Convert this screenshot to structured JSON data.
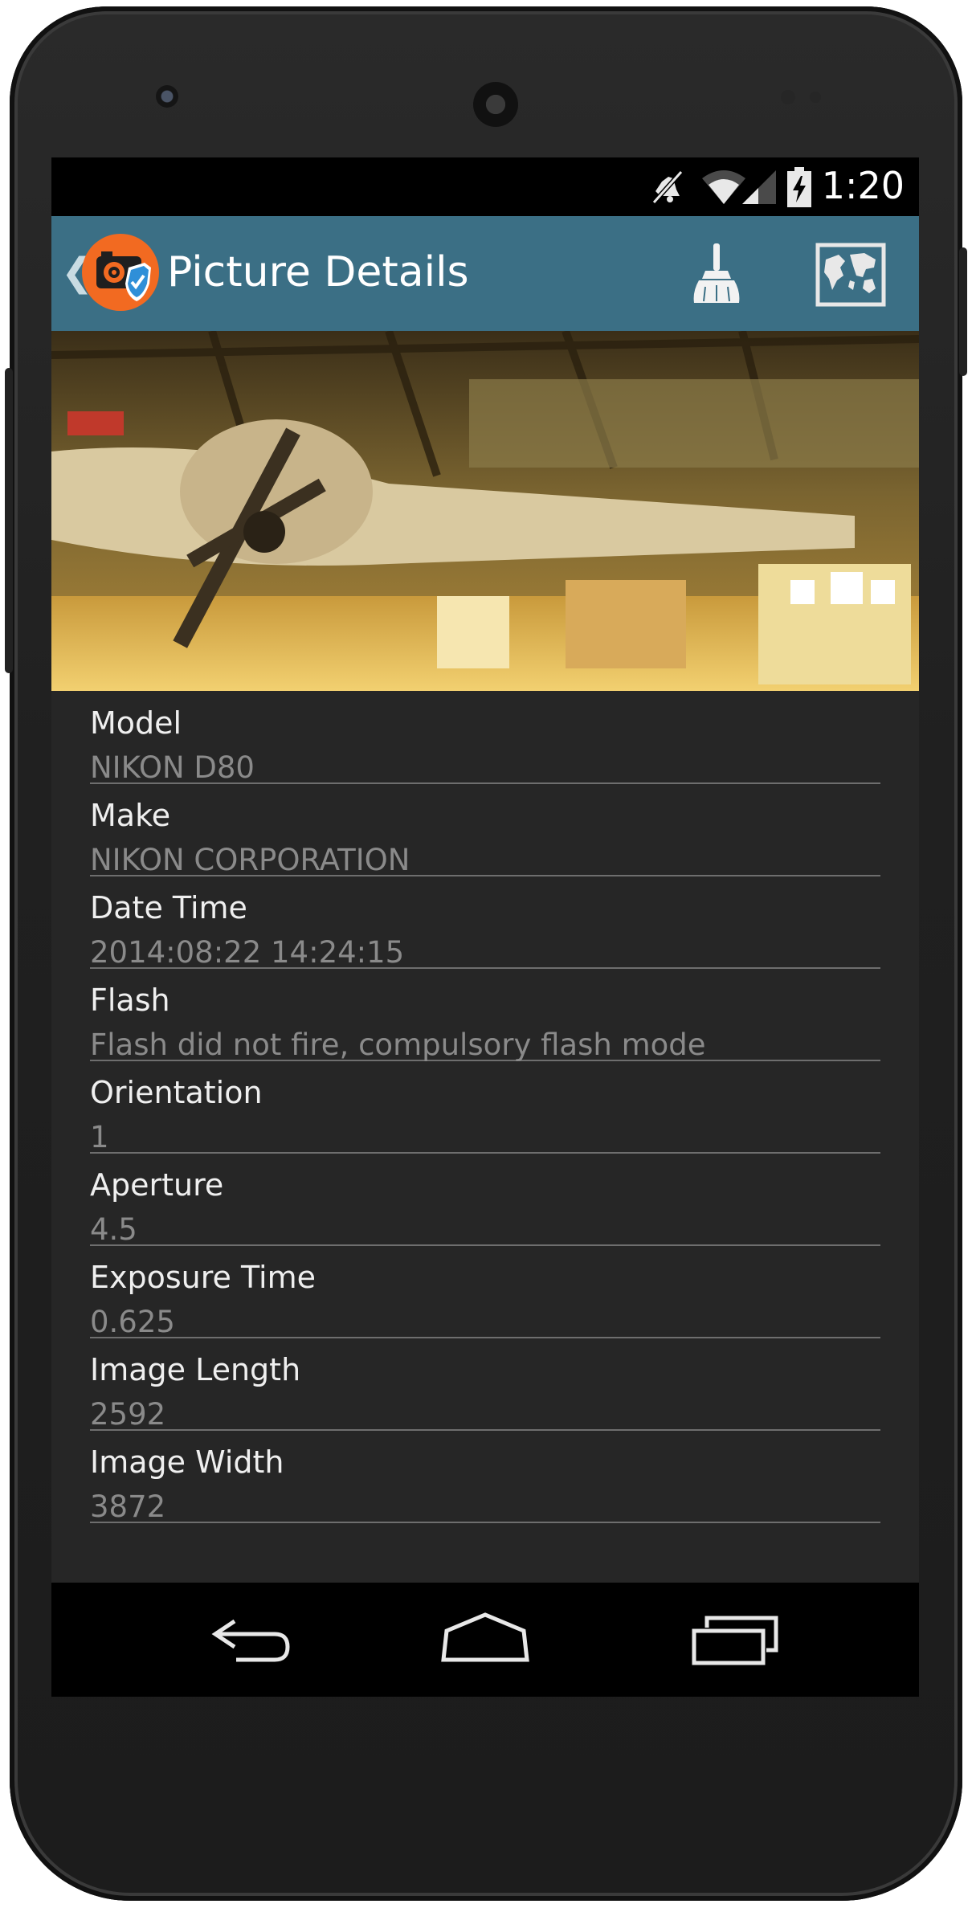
{
  "status_bar": {
    "time": "1:20"
  },
  "app_bar": {
    "title": "Picture Details"
  },
  "details": [
    {
      "label": "Model",
      "value": "NIKON D80"
    },
    {
      "label": "Make",
      "value": "NIKON CORPORATION"
    },
    {
      "label": "Date Time",
      "value": "2014:08:22 14:24:15"
    },
    {
      "label": "Flash",
      "value": "Flash did not fire, compulsory flash mode"
    },
    {
      "label": "Orientation",
      "value": "1"
    },
    {
      "label": "Aperture",
      "value": "4.5"
    },
    {
      "label": "Exposure Time",
      "value": "0.625"
    },
    {
      "label": "Image Length",
      "value": "2592"
    },
    {
      "label": "Image Width",
      "value": "3872"
    }
  ],
  "icons": {
    "back": "chevron-left-icon",
    "app_logo": "camera-shield-icon",
    "clear": "broom-icon",
    "map": "world-map-icon",
    "mute": "mute-icon",
    "wifi": "wifi-icon",
    "signal": "signal-icon",
    "battery": "battery-icon",
    "nav_back": "back-arrow-icon",
    "nav_home": "home-icon",
    "nav_recents": "recents-icon"
  },
  "colors": {
    "app_bar": "#3b6f85",
    "app_logo": "#f26a21",
    "detail_background": "#262626",
    "label_text": "#efefef",
    "value_text": "#8a8a8a",
    "divider": "#6e6e6e"
  }
}
